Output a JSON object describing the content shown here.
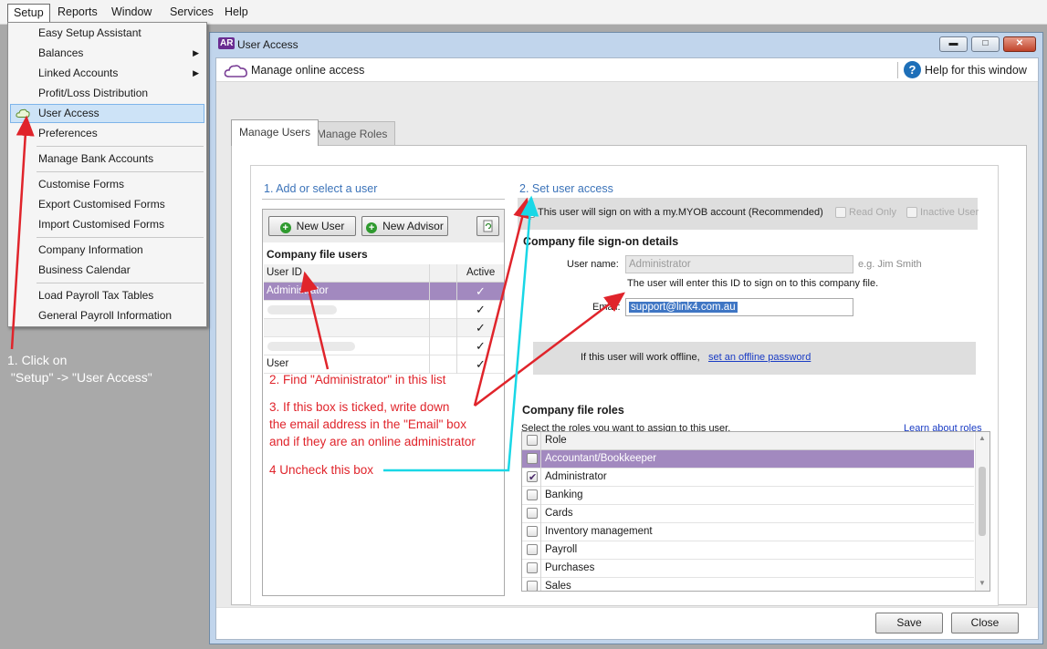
{
  "menubar": {
    "items": [
      "Setup",
      "Reports",
      "Window",
      "Services",
      "Help"
    ]
  },
  "setup_menu": {
    "items": [
      "Easy Setup Assistant",
      "Balances",
      "Linked Accounts",
      "Profit/Loss Distribution",
      "User Access",
      "Preferences",
      "Manage Bank Accounts",
      "Customise Forms",
      "Export Customised Forms",
      "Import Customised Forms",
      "Company Information",
      "Business Calendar",
      "Load Payroll Tax Tables",
      "General Payroll Information"
    ],
    "submenu_arrow": "▶"
  },
  "window": {
    "app_badge": "AR",
    "title": "User Access",
    "header": "Manage online access",
    "help": "Help for this window",
    "help_icon": "?",
    "controls": {
      "minimize": "▬",
      "maximize": "□",
      "close": "✕"
    }
  },
  "tabs": [
    "Manage Users",
    "Manage Roles"
  ],
  "left": {
    "heading": "1. Add or select a user",
    "new_user": "New User",
    "new_advisor": "New Advisor",
    "list_title": "Company file users",
    "col_user": "User ID",
    "col_active": "Active",
    "check_mark": "✓",
    "rows": [
      "Administrator",
      "",
      "",
      "",
      "User"
    ]
  },
  "right": {
    "heading": "2. Set user access",
    "myob_account": "This user will sign on with a my.MYOB account (Recommended)",
    "read_only": "Read Only",
    "inactive_user": "Inactive User",
    "signon_title": "Company file sign-on details",
    "username_label": "User name:",
    "username_value": "Administrator",
    "username_eg": "e.g. Jim Smith",
    "username_hint": "The user will enter this ID to sign on to this company file.",
    "email_label": "Email:",
    "email_value": "support@link4.com.au",
    "offline_text": "If this user will work offline,",
    "offline_link": "set an offline password",
    "roles_title": "Company file roles",
    "roles_hint": "Select the roles you want to assign to this user.",
    "roles_link": "Learn about roles",
    "roles_header": "Role",
    "roles": [
      "Accountant/Bookkeeper",
      "Administrator",
      "Banking",
      "Cards",
      "Inventory management",
      "Payroll",
      "Purchases",
      "Sales"
    ]
  },
  "footer": {
    "save": "Save",
    "close": "Close"
  },
  "annotations": {
    "step1_line1": "1. Click on",
    "step1_line2": " \"Setup\" -> \"User Access\"",
    "step2": "2. Find \"Administrator\" in this list",
    "step3_line1": "3. If this box is ticked, write down",
    "step3_line2": "the email address in the \"Email\" box",
    "step3_line3": "and if they are an online administrator",
    "step4": "4 Uncheck this box"
  },
  "colors": {
    "annotation_red": "#e0242b",
    "annotation_cyan": "#19d7e6",
    "selection_purple": "#a289bf",
    "link_blue": "#1a3cc4"
  }
}
